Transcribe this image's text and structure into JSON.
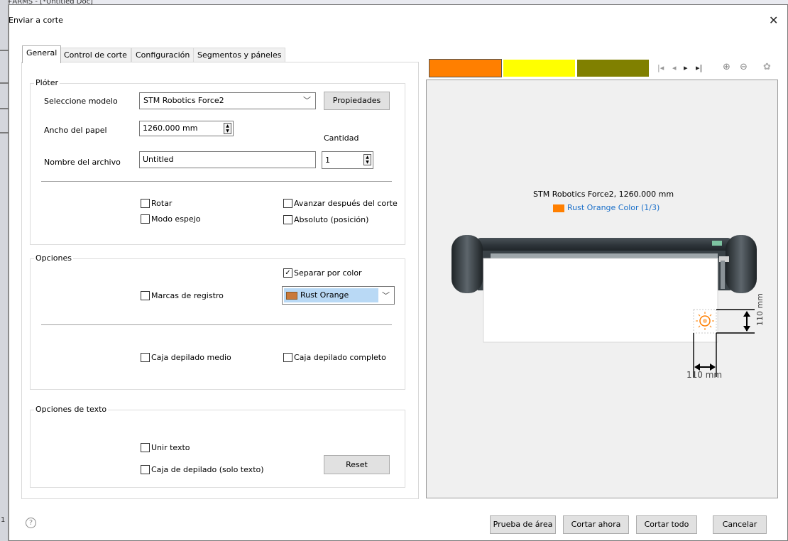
{
  "background": {
    "title_text": "+ARMS - [*Untitled Doc]",
    "page_number": "1"
  },
  "dialog": {
    "title": "Enviar a corte"
  },
  "tabs": [
    {
      "label": "General"
    },
    {
      "label": "Control de corte"
    },
    {
      "label": "Configuración"
    },
    {
      "label": "Segmentos y páneles"
    }
  ],
  "ploter": {
    "legend": "Plóter",
    "model_label": "Seleccione modelo",
    "model_value": "STM Robotics Force2",
    "properties_label": "Propiedades",
    "paper_width_label": "Ancho del papel",
    "paper_width_value": "1260.000 mm",
    "quantity_label": "Cantidad",
    "quantity_value": "1",
    "file_name_label": "Nombre del archivo",
    "file_name_value": "Untitled",
    "rotate_label": "Rotar",
    "rotate_checked": false,
    "mirror_label": "Modo espejo",
    "mirror_checked": false,
    "advance_label": "Avanzar después del corte",
    "advance_checked": false,
    "absolute_label": "Absoluto (posición)",
    "absolute_checked": false
  },
  "options": {
    "legend": "Opciones",
    "separate_label": "Separar por color",
    "separate_checked": true,
    "reg_marks_label": "Marcas de registro",
    "reg_marks_checked": false,
    "color_value": "Rust Orange",
    "weed_medium_label": "Caja depilado medio",
    "weed_medium_checked": false,
    "weed_full_label": "Caja depilado completo",
    "weed_full_checked": false
  },
  "text_options": {
    "legend": "Opciones de texto",
    "join_label": "Unir texto",
    "join_checked": false,
    "weed_text_label": "Caja de depilado (solo texto)",
    "weed_text_checked": false,
    "reset_label": "Reset"
  },
  "preview": {
    "color_swatches": [
      "#ff7f00",
      "#ffff00",
      "#808000"
    ],
    "plotter_info": "STM Robotics Force2,  1260.000 mm",
    "color_info": "Rust Orange Color (1/3)",
    "color_info_swatch": "#ff7f00",
    "dim_vertical": "110 mm",
    "dim_horizontal": "110 mm"
  },
  "footer": {
    "help_glyph": "?",
    "test_area_label": "Prueba de área",
    "cut_now_label": "Cortar ahora",
    "cut_all_label": "Cortar todo",
    "cancel_label": "Cancelar"
  }
}
